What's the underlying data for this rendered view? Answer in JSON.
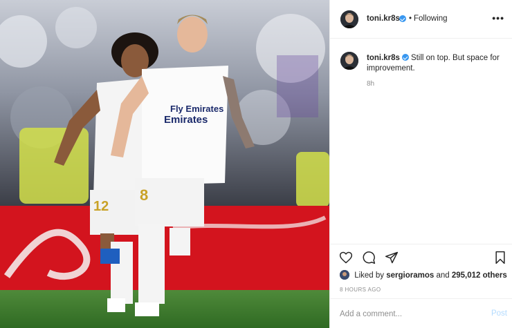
{
  "post": {
    "photo_alt": "Two Real Madrid players in white kits celebrating on the pitch",
    "photo_sponsor_text": "Fly Emirates",
    "photo_sponsor_text_2": "Emirates"
  },
  "header": {
    "username": "toni.kr8s",
    "separator": "•",
    "follow_status": "Following",
    "more": "•••"
  },
  "caption": {
    "username": "toni.kr8s",
    "text": "Still on top. But space for improvement.",
    "time": "8h"
  },
  "likes": {
    "prefix": "Liked by",
    "user": "sergioramos",
    "connector": "and",
    "count": "295,012 others"
  },
  "post_time": "8 HOURS AGO",
  "comment": {
    "placeholder": "Add a comment...",
    "post_label": "Post"
  },
  "icons": [
    "heart-icon",
    "comment-icon",
    "share-icon",
    "bookmark-icon",
    "verified-icon",
    "more-icon"
  ],
  "colors": {
    "verified": "#3897f0",
    "muted": "#8e8e8e",
    "post_disabled": "#b3dbff"
  }
}
